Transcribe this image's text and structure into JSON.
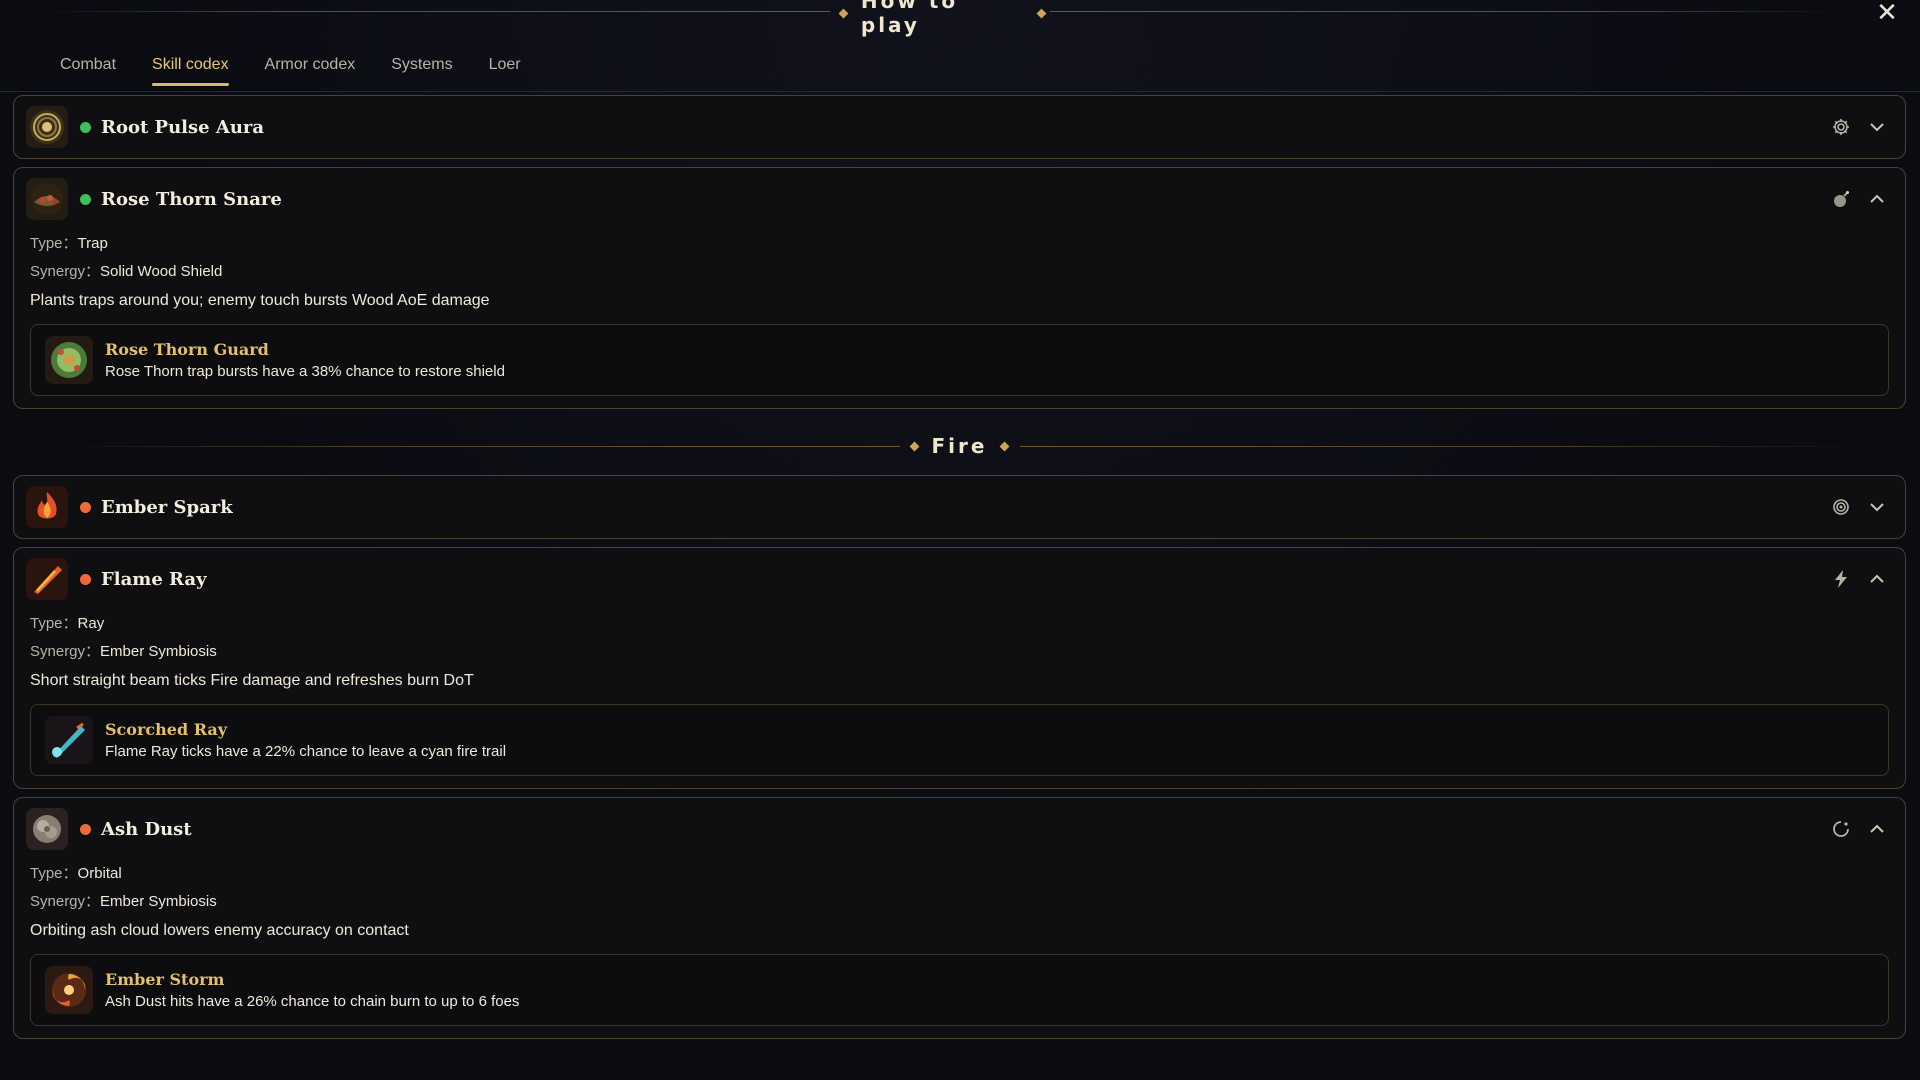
{
  "header": {
    "title": "How to play",
    "close_label": "✕"
  },
  "tabs": [
    {
      "label": "Combat",
      "active": false
    },
    {
      "label": "Skill codex",
      "active": true
    },
    {
      "label": "Armor codex",
      "active": false
    },
    {
      "label": "Systems",
      "active": false
    },
    {
      "label": "Loer",
      "active": false
    }
  ],
  "colors": {
    "accent_gold": "#d9b768",
    "wood_dot": "#3fbf5b",
    "fire_dot": "#ef6a3a",
    "upgrade_name": "#e3c06a"
  },
  "skills": {
    "root_pulse": {
      "name": "Root Pulse Aura",
      "element": "wood",
      "action_icon": "gear-icon",
      "expanded": false
    },
    "rose_thorn": {
      "name": "Rose Thorn Snare",
      "element": "wood",
      "action_icon": "bomb-icon",
      "expanded": true,
      "type_label": "Type：",
      "type_value": "Trap",
      "synergy_label": "Synergy：",
      "synergy_value": "Solid Wood Shield",
      "description": "Plants traps around you; enemy touch bursts Wood AoE damage",
      "upgrade": {
        "name": "Rose Thorn Guard",
        "description": "Rose Thorn trap bursts have a 38% chance to restore shield"
      }
    },
    "fire_section": "Fire",
    "ember_spark": {
      "name": "Ember Spark",
      "element": "fire",
      "action_icon": "target-icon",
      "expanded": false
    },
    "flame_ray": {
      "name": "Flame Ray",
      "element": "fire",
      "action_icon": "lightning-icon",
      "expanded": true,
      "type_label": "Type：",
      "type_value": "Ray",
      "synergy_label": "Synergy：",
      "synergy_value": "Ember Symbiosis",
      "description": "Short straight beam ticks Fire damage and refreshes burn DoT",
      "upgrade": {
        "name": "Scorched Ray",
        "description": "Flame Ray ticks have a 22% chance to leave a cyan fire trail"
      }
    },
    "ash_dust": {
      "name": "Ash Dust",
      "element": "fire",
      "action_icon": "orbit-icon",
      "expanded": true,
      "type_label": "Type：",
      "type_value": "Orbital",
      "synergy_label": "Synergy：",
      "synergy_value": "Ember Symbiosis",
      "description": "Orbiting ash cloud lowers enemy accuracy on contact",
      "upgrade": {
        "name": "Ember Storm",
        "description": "Ash Dust hits have a 26% chance to chain burn to up to 6 foes"
      }
    }
  }
}
